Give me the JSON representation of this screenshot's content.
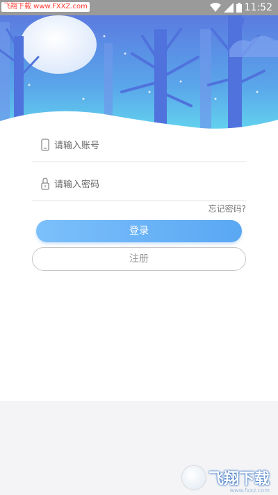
{
  "status_bar": {
    "watermark": "飞翔下载 www.FXXZ.com",
    "time": "11:52",
    "icons": [
      "wifi-icon",
      "signal-icon",
      "battery-icon"
    ]
  },
  "login": {
    "account_placeholder": "请输入账号",
    "password_placeholder": "请输入密码",
    "forgot_label": "忘记密码?",
    "login_label": "登录",
    "register_label": "注册"
  },
  "watermark_logo": {
    "text": "飞翔下载",
    "url": "www.fxxz.com"
  },
  "colors": {
    "accent": "#5aa7f3",
    "hero_top": "#5b7be0",
    "hero_bottom": "#63d6ee"
  }
}
